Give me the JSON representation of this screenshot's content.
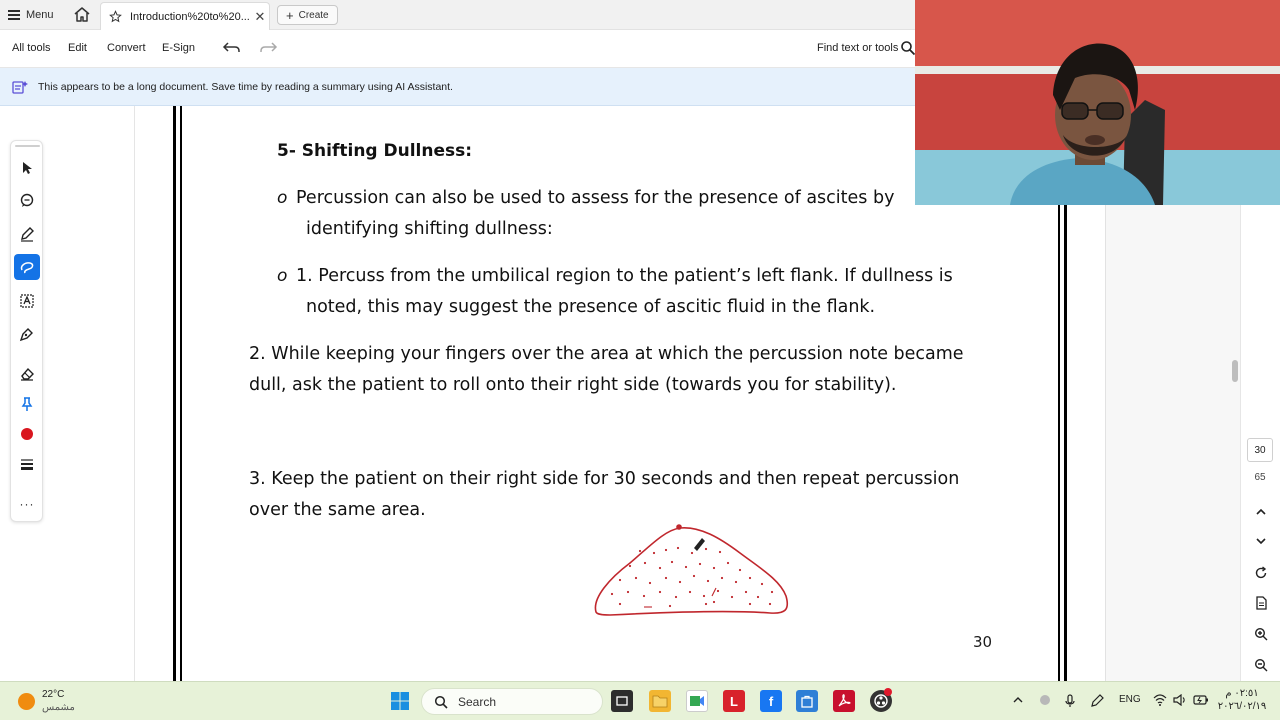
{
  "tabbar": {
    "menu_label": "Menu",
    "tab_title": "Introduction%20to%20...",
    "create_label": "Create"
  },
  "toolbar": {
    "all_tools": "All tools",
    "edit": "Edit",
    "convert": "Convert",
    "esign": "E-Sign",
    "find_label": "Find text or tools"
  },
  "banner": {
    "text": "This appears to be a long document. Save time by reading a summary using AI Assistant."
  },
  "document": {
    "heading": "5-  Shifting Dullness:",
    "bullet_char": "o",
    "b1_line1": "Percussion can also be used to assess for the presence of ascites by",
    "b1_line2": "identifying shifting dullness:",
    "b2_line1": "1. Percuss from the umbilical region to the patient’s left flank. If dullness is",
    "b2_line2": "noted, this may suggest the presence of ascitic fluid in the flank.",
    "p2_line1": "2. While keeping your fingers over the area at which the percussion note became",
    "p2_line2": "dull, ask the patient to roll onto their right side (towards you for stability).",
    "p3_line1": "3. Keep the patient on their right side for 30 seconds and then repeat percussion",
    "p3_line2": "over the same area.",
    "page_number": "30"
  },
  "right_panel": {
    "current_page": "30",
    "total_pages": "65"
  },
  "taskbar": {
    "temperature": "22°C",
    "weather_desc": "مشمس",
    "search_label": "Search",
    "language": "ENG",
    "time": "٠٢:٥١ م",
    "date": "٢٠٢٦/٠٢/١٩"
  },
  "colors": {
    "accent": "#1473e6",
    "annotation": "#c0272d",
    "banner_bg": "#e6f1fc",
    "taskbar_bg": "#e7f2d8"
  }
}
